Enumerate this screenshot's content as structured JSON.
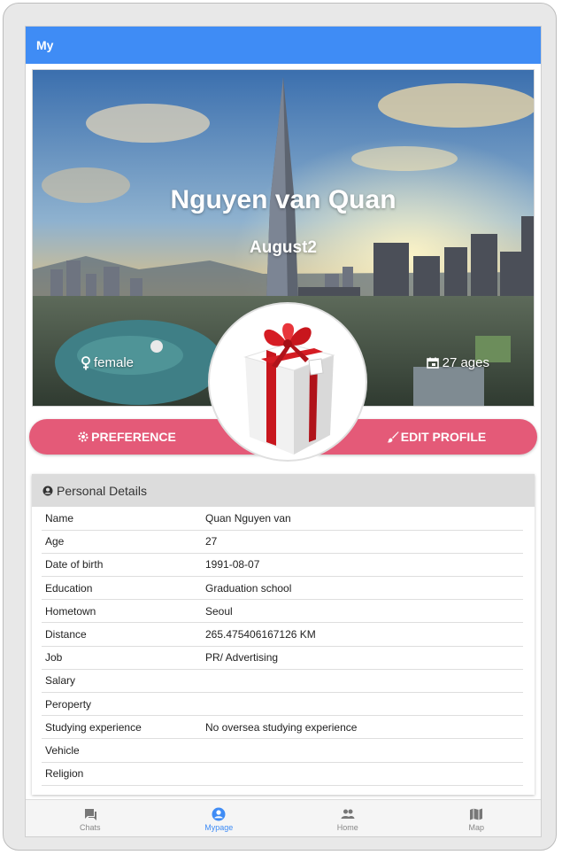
{
  "header": {
    "title": "My"
  },
  "profile": {
    "name": "Nguyen van Quan",
    "nickname": "August2",
    "gender": "female",
    "age": "27 ages"
  },
  "actions": {
    "preference_label": "PREFERENCE",
    "edit_label": "EDIT PROFILE"
  },
  "details": {
    "title": "Personal Details",
    "rows": [
      {
        "label": "Name",
        "value": "Quan Nguyen van"
      },
      {
        "label": "Age",
        "value": "27"
      },
      {
        "label": "Date of birth",
        "value": "1991-08-07"
      },
      {
        "label": "Education",
        "value": "Graduation school"
      },
      {
        "label": "Hometown",
        "value": "Seoul"
      },
      {
        "label": "Distance",
        "value": "265.475406167126 KM"
      },
      {
        "label": "Job",
        "value": "PR/ Advertising"
      },
      {
        "label": "Salary",
        "value": ""
      },
      {
        "label": "Peroperty",
        "value": ""
      },
      {
        "label": "Studying experience",
        "value": "No oversea studying experience"
      },
      {
        "label": "Vehicle",
        "value": ""
      },
      {
        "label": "Religion",
        "value": ""
      }
    ]
  },
  "nav": {
    "items": [
      {
        "label": "Chats",
        "icon": "chat-icon"
      },
      {
        "label": "Mypage",
        "icon": "account-circle-icon",
        "active": true
      },
      {
        "label": "Home",
        "icon": "people-icon"
      },
      {
        "label": "Map",
        "icon": "map-icon"
      }
    ]
  },
  "colors": {
    "primary": "#3f8cf5",
    "accent": "#e45a78"
  }
}
